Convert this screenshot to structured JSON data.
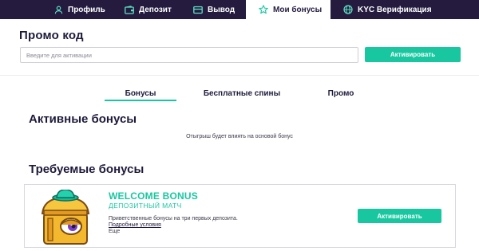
{
  "nav": {
    "tabs": [
      {
        "label": "Профиль",
        "icon": "user-icon"
      },
      {
        "label": "Депозит",
        "icon": "wallet-icon"
      },
      {
        "label": "Вывод",
        "icon": "withdraw-icon"
      },
      {
        "label": "Мои бонусы",
        "icon": "star-icon",
        "active": true
      },
      {
        "label": "KYC Верификация",
        "icon": "globe-icon"
      }
    ]
  },
  "promo": {
    "title": "Промо код",
    "placeholder": "Введите для активации",
    "button_label": "Активировать"
  },
  "subtabs": [
    {
      "label": "Бонусы",
      "active": true
    },
    {
      "label": "Бесплатные спины"
    },
    {
      "label": "Промо"
    }
  ],
  "active_bonuses": {
    "title": "Активные бонусы",
    "note": "Отыгрыш будет влиять на основой бонус"
  },
  "required_bonuses": {
    "title": "Требуемые бонусы",
    "card": {
      "name": "WELCOME BONUS",
      "type": "ДЕПОЗИТНЫЙ МАТЧ",
      "description": "Приветственные бонусы на три первых депозита.",
      "terms_link": "Подробные условия",
      "more": "Еще",
      "button_label": "Активировать",
      "image": "treasure-chest-icon"
    }
  },
  "colors": {
    "nav_bg": "#241b3f",
    "accent": "#18c7a0",
    "text": "#1e1b3a"
  }
}
